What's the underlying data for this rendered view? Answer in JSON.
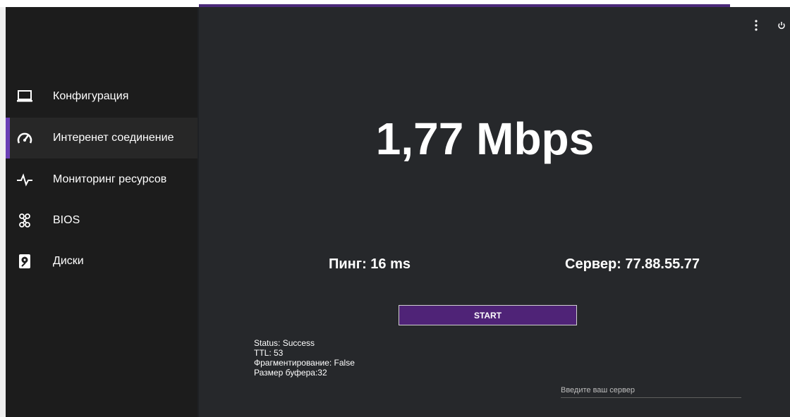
{
  "sidebar": {
    "items": [
      {
        "label": "Конфигурация",
        "icon": "laptop-icon"
      },
      {
        "label": "Интеренет соединение",
        "icon": "speedometer-icon",
        "active": true
      },
      {
        "label": "Мониторинг ресурсов",
        "icon": "pulse-icon"
      },
      {
        "label": "BIOS",
        "icon": "chip-icon"
      },
      {
        "label": "Диски",
        "icon": "hard-disk-icon"
      }
    ]
  },
  "header": {
    "menu_icon": "more-vertical-icon",
    "power_icon": "power-icon"
  },
  "main": {
    "speed": "1,77 Mbps",
    "ping": "Пинг: 16 ms",
    "server": "Сервер: 77.88.55.77",
    "start_label": "START",
    "status": {
      "line1": "Status: Success",
      "line2": "TTL: 53",
      "line3": "Фрагментирование: False",
      "line4": "Размер буфера:32"
    },
    "server_input": {
      "value": "",
      "placeholder": "Введите ваш сервер"
    }
  },
  "colors": {
    "accent": "#6a3fb5",
    "button": "#4f2377",
    "sidebar_bg": "#1c1c1c",
    "main_bg": "#26282b"
  }
}
